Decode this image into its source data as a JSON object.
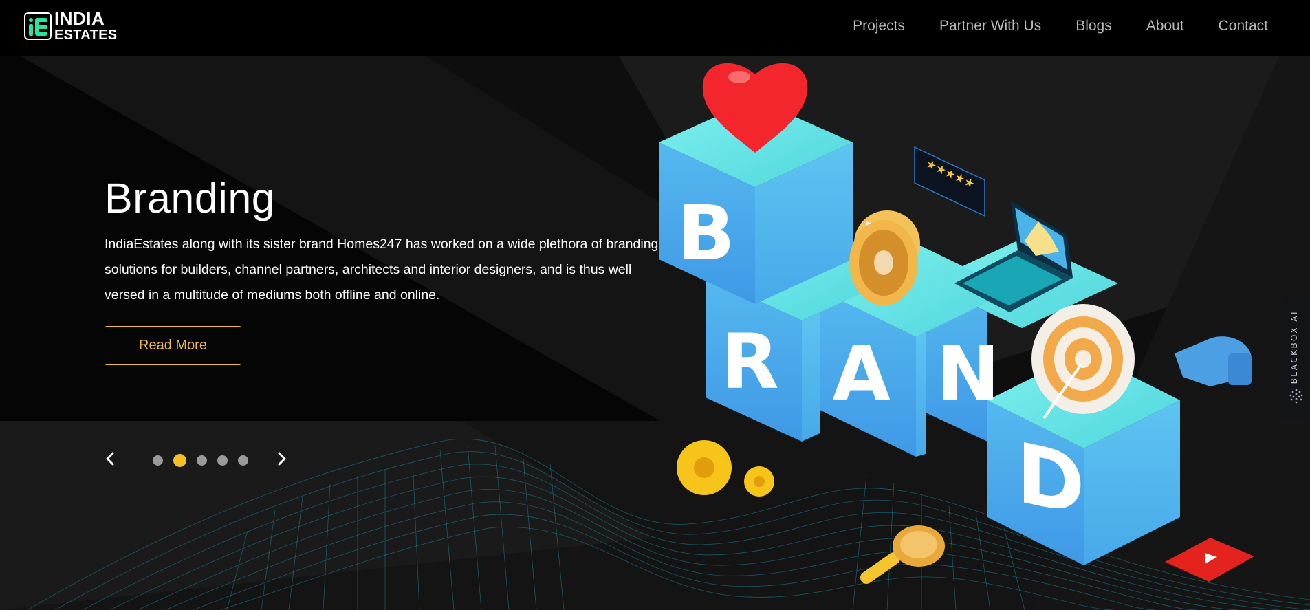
{
  "header": {
    "logo": {
      "line1": "INDIA",
      "line2": "ESTATES"
    },
    "nav": [
      {
        "label": "Projects"
      },
      {
        "label": "Partner With Us"
      },
      {
        "label": "Blogs"
      },
      {
        "label": "About"
      },
      {
        "label": "Contact"
      }
    ]
  },
  "hero": {
    "title": "Branding",
    "description": "IndiaEstates along with its sister brand Homes247 has worked on a wide plethora of branding solutions for builders, channel partners, architects and interior designers, and is thus well versed in a multitude of mediums both offline and online.",
    "cta_label": "Read More",
    "carousel": {
      "slide_count": 5,
      "active_slide": 2
    },
    "illustration_letters": [
      "B",
      "R",
      "A",
      "N",
      "D"
    ]
  },
  "side_widget": {
    "label": "BLACKBOX AI"
  },
  "colors": {
    "accent": "#f3c02c",
    "brand_green": "#29e3a0",
    "background": "#0c0c0c",
    "header": "#000000",
    "nav_text": "#b9b9b9"
  }
}
